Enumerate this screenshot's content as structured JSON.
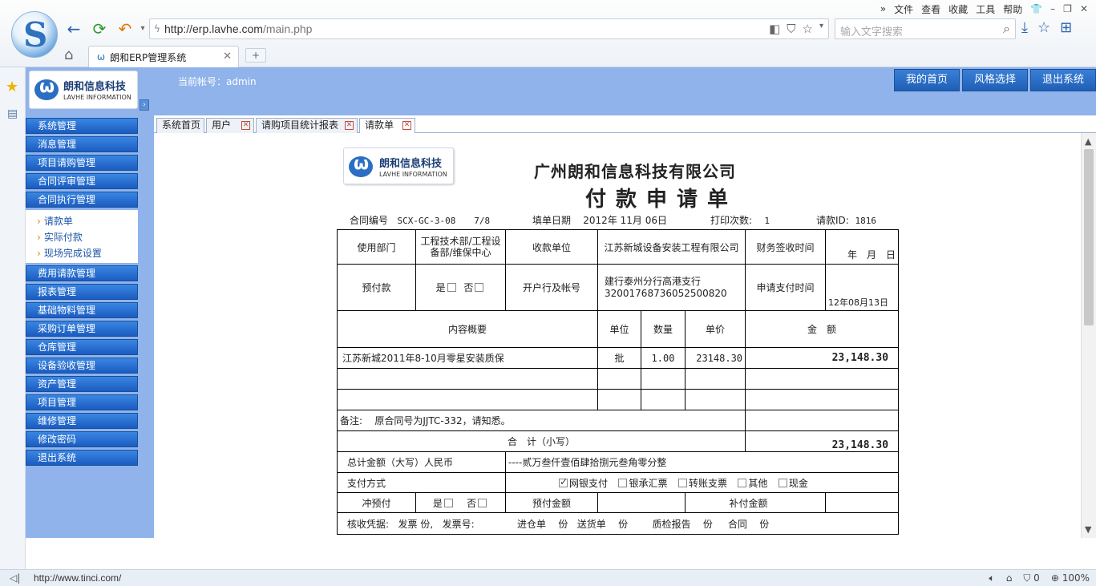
{
  "browser": {
    "menu": [
      "文件",
      "查看",
      "收藏",
      "工具",
      "帮助"
    ],
    "url_host": "http://erp.lavhe.com",
    "url_path": "/main.php",
    "search_placeholder": "输入文字搜索",
    "tab_title": "朗和ERP管理系统",
    "status_url": "http://www.tinci.com/",
    "status_count": "0",
    "zoom": "100%"
  },
  "app": {
    "logo_cn": "朗和信息科技",
    "logo_en": "LAVHE INFORMATION",
    "account": "当前帐号：admin",
    "header_buttons": [
      "我的首页",
      "风格选择",
      "退出系统"
    ]
  },
  "sidebar": {
    "top_items": [
      "系统管理",
      "消息管理",
      "项目请购管理",
      "合同评审管理",
      "合同执行管理"
    ],
    "sub_items": [
      "请款单",
      "实际付款",
      "现场完成设置"
    ],
    "bottom_items": [
      "费用请款管理",
      "报表管理",
      "基础物料管理",
      "采购订单管理",
      "仓库管理",
      "设备验收管理",
      "资产管理",
      "项目管理",
      "维修管理",
      "修改密码",
      "退出系统"
    ]
  },
  "content_tabs": [
    "系统首页",
    "用户",
    "请购项目统计报表",
    "请款单"
  ],
  "form": {
    "company": "广州朗和信息科技有限公司",
    "title": "付款申请单",
    "contract_no_label": "合同编号",
    "contract_no": "SCX-GC-3-08",
    "contract_seq": "7/8",
    "fill_date_label": "填单日期",
    "fill_date": "2012年 11月 06日",
    "print_label": "打印次数:",
    "print_count": "1",
    "request_id_label": "请款ID:",
    "request_id": "1816",
    "dept_label": "使用部门",
    "dept": "工程技术部/工程设备部/维保中心",
    "payee_label": "收款单位",
    "payee": "江苏新城设备安装工程有限公司",
    "finance_sign_label": "财务签收时间",
    "finance_sign_value": "年　月　日",
    "prepay_label": "预付款",
    "yes": "是",
    "no": "否",
    "bank_label": "开户行及帐号",
    "bank_name": "建行泰州分行高港支行",
    "bank_account": "32001768736052500820",
    "apply_pay_label": "申请支付时间",
    "apply_pay_value": "12年08月13日",
    "col_content": "内容概要",
    "col_unit": "单位",
    "col_qty": "数量",
    "col_price": "单价",
    "col_amount": "金　额",
    "item_desc": "江苏新城2011年8-10月零星安装质保",
    "item_unit": "批",
    "item_qty": "1.00",
    "item_price": "23148.30",
    "item_amount": "23,148.30",
    "remark_label": "备注:",
    "remark": "原合同号为JJTC-332，请知悉。",
    "subtotal_label": "合　计（小写）",
    "subtotal": "23,148.30",
    "total_cn_label": "总计金额（大写）人民币",
    "total_cn": "----贰万叁仟壹佰肆拾捌元叁角零分整",
    "pay_method_label": "支付方式",
    "pay_methods": [
      "网银支付",
      "银承汇票",
      "转账支票",
      "其他",
      "现金"
    ],
    "offset_label": "冲预付",
    "prepay_amount_label": "预付金额",
    "supplement_label": "补付金额",
    "verify_line": [
      "核收凭据:",
      "发票 份,",
      "发票号:",
      "进仓单",
      "份",
      "送货单",
      "份",
      "质检报告",
      "份",
      "合同",
      "份"
    ]
  }
}
